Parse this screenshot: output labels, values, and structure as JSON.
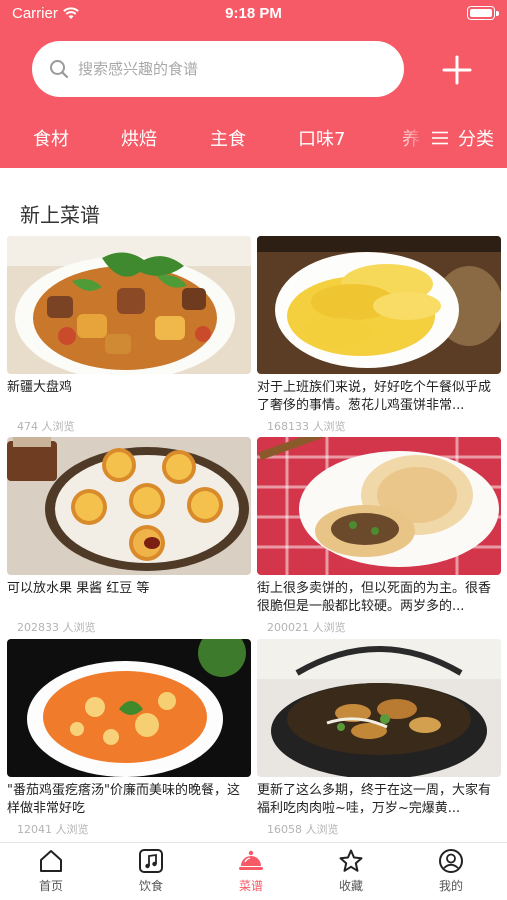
{
  "status_bar": {
    "carrier": "Carrier",
    "time": "9:18 PM"
  },
  "search": {
    "placeholder": "搜索感兴趣的食谱"
  },
  "categories": [
    "食材",
    "烘焙",
    "主食",
    "口味7",
    "养"
  ],
  "classify_label": "分类",
  "section": {
    "title": "新上菜谱"
  },
  "recipes": [
    {
      "title": "新疆大盘鸡",
      "views": "474 人浏览"
    },
    {
      "title": "对于上班族们来说，好好吃个午餐似乎成了奢侈的事情。葱花儿鸡蛋饼非常...",
      "views": "168133 人浏览"
    },
    {
      "title": "可以放水果 果酱 红豆 等",
      "views": "202833 人浏览"
    },
    {
      "title": "街上很多卖饼的，但以死面的为主。很香很脆但是一般都比较硬。两岁多的...",
      "views": "200021 人浏览"
    },
    {
      "title": "\"番茄鸡蛋疙瘩汤\"价廉而美味的晚餐，这样做非常好吃",
      "views": "12041 人浏览"
    },
    {
      "title": "更新了这么多期，终于在这一周，大家有福利吃肉肉啦~哇，万岁~完爆黄...",
      "views": "16058 人浏览"
    }
  ],
  "tabs": [
    {
      "label": "首页",
      "icon": "home-icon"
    },
    {
      "label": "饮食",
      "icon": "music-note-icon"
    },
    {
      "label": "菜谱",
      "icon": "cloche-icon",
      "active": true
    },
    {
      "label": "收藏",
      "icon": "star-icon"
    },
    {
      "label": "我的",
      "icon": "user-icon"
    }
  ],
  "colors": {
    "brand": "#f65a66",
    "views_text": "#b3b3b3"
  }
}
